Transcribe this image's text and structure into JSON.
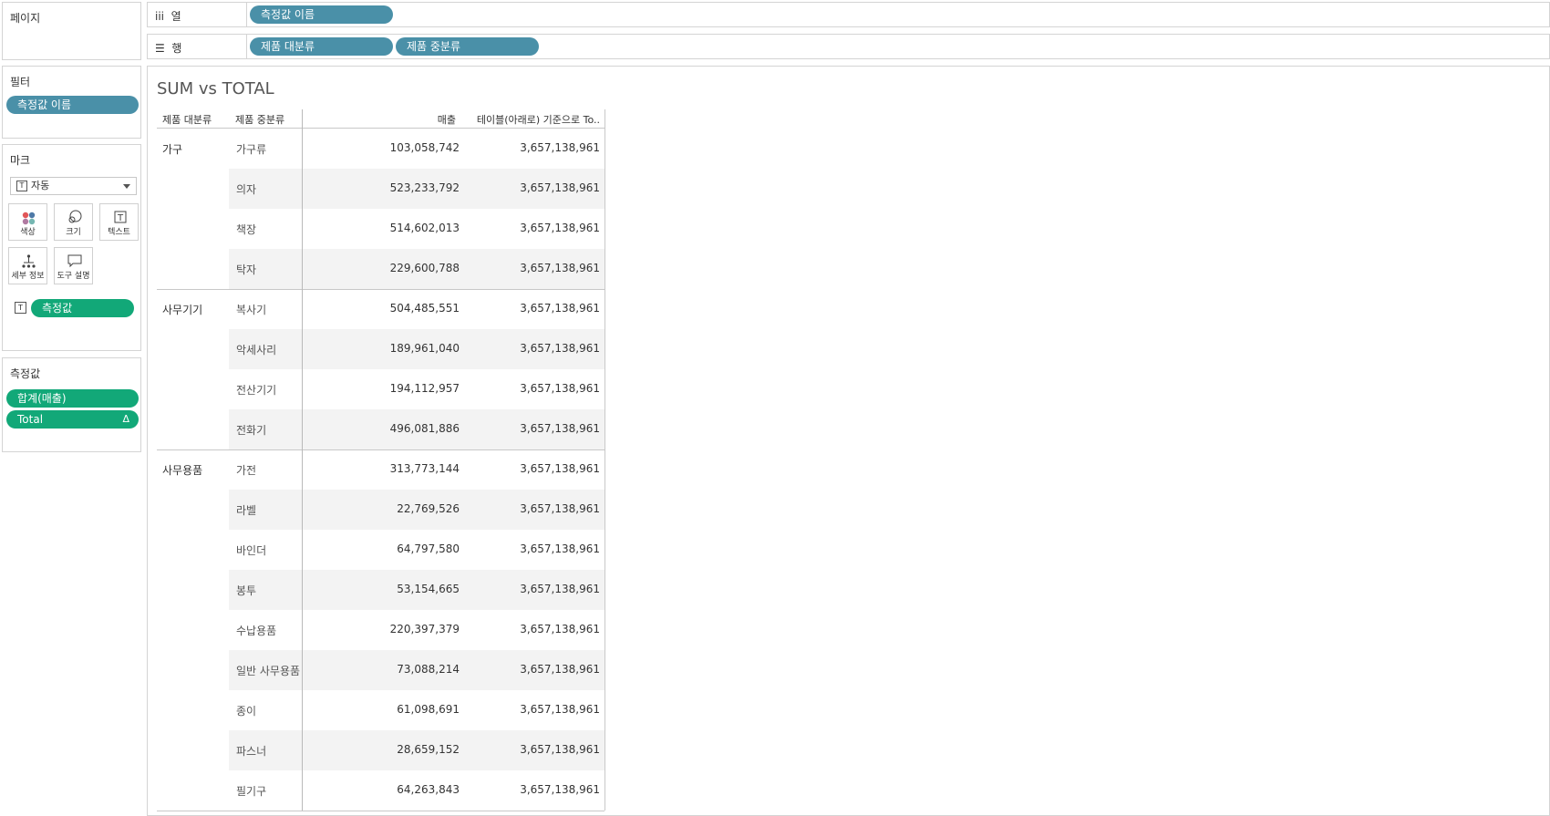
{
  "pages_panel": {
    "title": "페이지"
  },
  "filters_panel": {
    "title": "필터",
    "pills": [
      "측정값 이름"
    ]
  },
  "marks_panel": {
    "title": "마크",
    "mark_type": "자동",
    "buttons": [
      "색상",
      "크기",
      "텍스트",
      "세부 정보",
      "도구 설명"
    ],
    "text_pill": "측정값"
  },
  "measures_panel": {
    "title": "측정값",
    "pills": [
      {
        "label": "합계(매출)"
      },
      {
        "label": "Total",
        "delta": "Δ"
      }
    ]
  },
  "columns_shelf": {
    "label": "열",
    "pills": [
      "측정값 이름"
    ]
  },
  "rows_shelf": {
    "label": "행",
    "pills": [
      "제품 대분류",
      "제품 중분류"
    ]
  },
  "view": {
    "title": "SUM vs TOTAL",
    "headers": [
      "제품 대분류",
      "제품 중분류",
      "매출",
      "테이블(아래로) 기준으로 To.."
    ],
    "groups": [
      {
        "name": "가구",
        "rows": [
          [
            "가구류",
            "103,058,742",
            "3,657,138,961"
          ],
          [
            "의자",
            "523,233,792",
            "3,657,138,961"
          ],
          [
            "책장",
            "514,602,013",
            "3,657,138,961"
          ],
          [
            "탁자",
            "229,600,788",
            "3,657,138,961"
          ]
        ]
      },
      {
        "name": "사무기기",
        "rows": [
          [
            "복사기",
            "504,485,551",
            "3,657,138,961"
          ],
          [
            "악세사리",
            "189,961,040",
            "3,657,138,961"
          ],
          [
            "전산기기",
            "194,112,957",
            "3,657,138,961"
          ],
          [
            "전화기",
            "496,081,886",
            "3,657,138,961"
          ]
        ]
      },
      {
        "name": "사무용품",
        "rows": [
          [
            "가전",
            "313,773,144",
            "3,657,138,961"
          ],
          [
            "라벨",
            "22,769,526",
            "3,657,138,961"
          ],
          [
            "바인더",
            "64,797,580",
            "3,657,138,961"
          ],
          [
            "봉투",
            "53,154,665",
            "3,657,138,961"
          ],
          [
            "수납용품",
            "220,397,379",
            "3,657,138,961"
          ],
          [
            "일반 사무용품",
            "73,088,214",
            "3,657,138,961"
          ],
          [
            "종이",
            "61,098,691",
            "3,657,138,961"
          ],
          [
            "파스너",
            "28,659,152",
            "3,657,138,961"
          ],
          [
            "필기구",
            "64,263,843",
            "3,657,138,961"
          ]
        ]
      }
    ]
  }
}
